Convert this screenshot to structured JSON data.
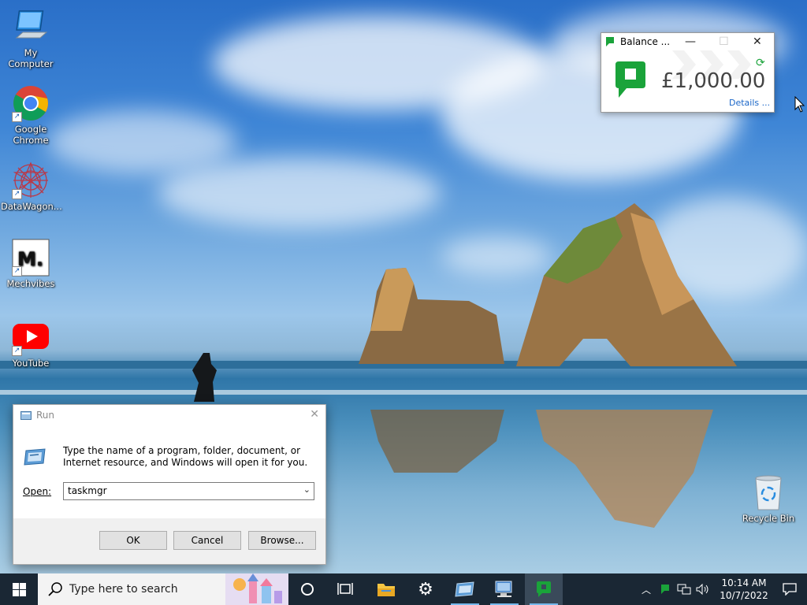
{
  "desktop": {
    "icons": [
      {
        "label": "My Computer"
      },
      {
        "label": "Google Chrome"
      },
      {
        "label": "DataWagon..."
      },
      {
        "label": "Mechvibes"
      },
      {
        "label": "YouTube"
      },
      {
        "label": "Recycle Bin"
      }
    ]
  },
  "balance_widget": {
    "title": "Balance ...",
    "amount": "£1,000.00",
    "details_link": "Details ...",
    "brand_color": "#1aa33a"
  },
  "run_dialog": {
    "title": "Run",
    "description": "Type the name of a program, folder, document, or Internet resource, and Windows will open it for you.",
    "open_label": "Open:",
    "open_value": "taskmgr",
    "buttons": {
      "ok": "OK",
      "cancel": "Cancel",
      "browse": "Browse..."
    }
  },
  "taskbar": {
    "search_placeholder": "Type here to search",
    "clock_time": "10:14 AM",
    "clock_date": "10/7/2022",
    "accent_color": "#76b9ed"
  }
}
